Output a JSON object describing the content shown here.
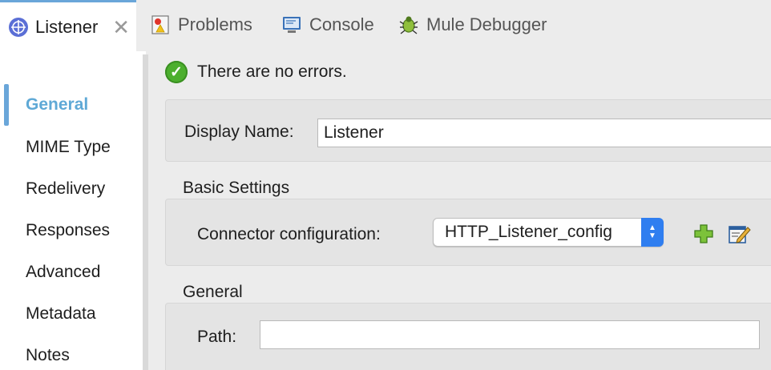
{
  "tabs": [
    {
      "label": "Listener",
      "icon": "globe-icon",
      "active": true
    },
    {
      "label": "Problems",
      "icon": "problems-icon"
    },
    {
      "label": "Console",
      "icon": "console-icon"
    },
    {
      "label": "Mule Debugger",
      "icon": "bug-icon"
    }
  ],
  "status": {
    "message": "There are no errors.",
    "icon": "check-icon"
  },
  "sidebar": {
    "items": [
      {
        "label": "General",
        "active": true
      },
      {
        "label": "MIME Type"
      },
      {
        "label": "Redelivery"
      },
      {
        "label": "Responses"
      },
      {
        "label": "Advanced"
      },
      {
        "label": "Metadata"
      },
      {
        "label": "Notes"
      }
    ]
  },
  "form": {
    "display_name_label": "Display Name:",
    "display_name_value": "Listener",
    "basic_settings_title": "Basic Settings",
    "connector_config_label": "Connector configuration:",
    "connector_config_value": "HTTP_Listener_config",
    "general_title": "General",
    "path_label": "Path:",
    "path_value": ""
  },
  "colors": {
    "accent": "#6aa6d9",
    "active_nav": "#5fa9d6",
    "select_blue": "#2f7ef0",
    "success": "#4caf2e"
  }
}
